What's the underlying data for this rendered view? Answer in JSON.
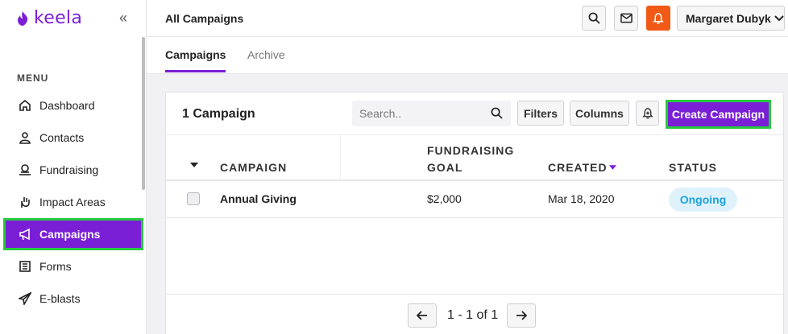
{
  "brand": {
    "name": "keela",
    "color": "#7a1fd6"
  },
  "sidebar": {
    "menu_label": "MENU",
    "items": [
      {
        "label": "Dashboard",
        "icon": "home-icon"
      },
      {
        "label": "Contacts",
        "icon": "user-icon"
      },
      {
        "label": "Fundraising",
        "icon": "money-icon"
      },
      {
        "label": "Impact Areas",
        "icon": "hand-icon"
      },
      {
        "label": "Campaigns",
        "icon": "megaphone-icon",
        "active": true
      },
      {
        "label": "Forms",
        "icon": "form-icon"
      },
      {
        "label": "E-blasts",
        "icon": "paper-plane-icon"
      }
    ]
  },
  "header": {
    "title": "All Campaigns",
    "user_name": "Margaret Dubyk"
  },
  "tabs": [
    {
      "label": "Campaigns",
      "active": true
    },
    {
      "label": "Archive",
      "active": false
    }
  ],
  "card": {
    "title": "1 Campaign",
    "search_placeholder": "Search..",
    "filters_label": "Filters",
    "columns_label": "Columns",
    "create_label": "Create Campaign"
  },
  "table": {
    "columns": [
      "CAMPAIGN",
      "FUNDRAISING",
      "GOAL",
      "CREATED",
      "STATUS"
    ],
    "rows": [
      {
        "campaign": "Annual Giving",
        "goal": "$2,000",
        "created": "Mar 18, 2020",
        "status": "Ongoing"
      }
    ]
  },
  "pagination": {
    "text": "1 - 1 of 1"
  },
  "colors": {
    "accent": "#7a1fd6",
    "highlight": "#27c93f",
    "alert": "#f05a16",
    "status_text": "#1ba2e0",
    "status_bg": "#dff2fb"
  }
}
